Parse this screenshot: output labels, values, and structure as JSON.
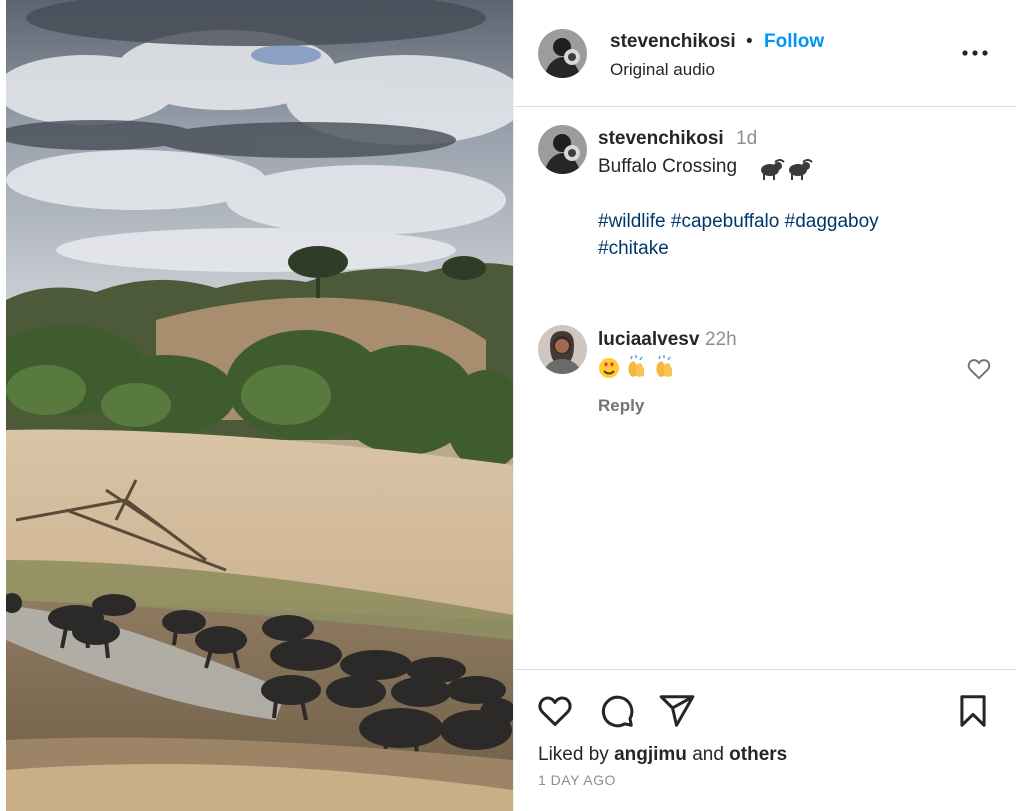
{
  "post": {
    "author": "stevenchikosi",
    "separator": "•",
    "follow_label": "Follow",
    "audio": "Original audio",
    "more_icon": "more-horizontal-icon"
  },
  "caption": {
    "author": "stevenchikosi",
    "time": "1d",
    "text": "Buffalo Crossing",
    "emoji_icons": [
      "water-buffalo-icon",
      "water-buffalo-icon"
    ],
    "hashtags": [
      "#wildlife",
      "#capebuffalo",
      "#daggaboy",
      "#chitake"
    ]
  },
  "comment": {
    "author": "luciaalvesv",
    "time": "22h",
    "emoji_icons": [
      "heart-eyes-icon",
      "clapping-hands-icon",
      "clapping-hands-icon"
    ],
    "reply_label": "Reply",
    "like_icon": "heart-outline-icon"
  },
  "actions": {
    "like_icon": "heart-icon",
    "comment_icon": "comment-icon",
    "share_icon": "send-icon",
    "save_icon": "bookmark-icon"
  },
  "likes": {
    "prefix": "Liked by",
    "user": "angjimu",
    "conjunction": "and",
    "others": "others"
  },
  "timestamp": "1 DAY AGO",
  "colors": {
    "accent": "#0095f6",
    "hashtag": "#00376b",
    "muted": "#8e8e8e",
    "text": "#262626",
    "border": "#dbdbdb"
  }
}
